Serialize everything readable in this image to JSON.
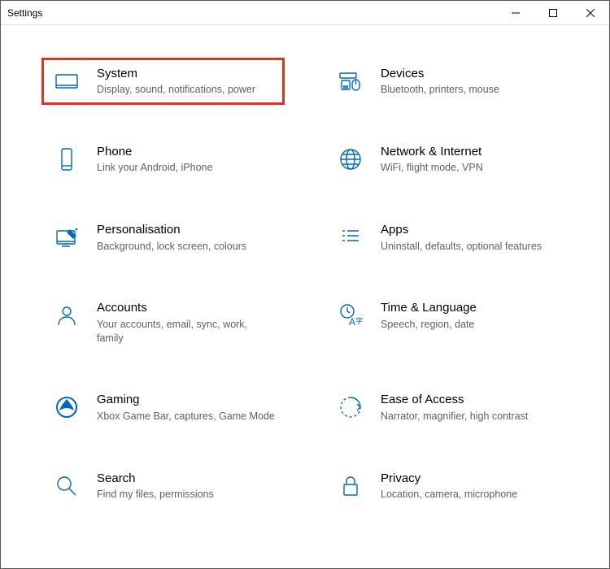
{
  "window": {
    "title": "Settings"
  },
  "categories": [
    {
      "id": "system",
      "title": "System",
      "desc": "Display, sound, notifications, power",
      "highlighted": true
    },
    {
      "id": "devices",
      "title": "Devices",
      "desc": "Bluetooth, printers, mouse"
    },
    {
      "id": "phone",
      "title": "Phone",
      "desc": "Link your Android, iPhone"
    },
    {
      "id": "network",
      "title": "Network & Internet",
      "desc": "WiFi, flight mode, VPN"
    },
    {
      "id": "personalisation",
      "title": "Personalisation",
      "desc": "Background, lock screen, colours"
    },
    {
      "id": "apps",
      "title": "Apps",
      "desc": "Uninstall, defaults, optional features"
    },
    {
      "id": "accounts",
      "title": "Accounts",
      "desc": "Your accounts, email, sync, work, family"
    },
    {
      "id": "time",
      "title": "Time & Language",
      "desc": "Speech, region, date"
    },
    {
      "id": "gaming",
      "title": "Gaming",
      "desc": "Xbox Game Bar, captures, Game Mode"
    },
    {
      "id": "ease",
      "title": "Ease of Access",
      "desc": "Narrator, magnifier, high contrast"
    },
    {
      "id": "search",
      "title": "Search",
      "desc": "Find my files, permissions"
    },
    {
      "id": "privacy",
      "title": "Privacy",
      "desc": "Location, camera, microphone"
    }
  ]
}
